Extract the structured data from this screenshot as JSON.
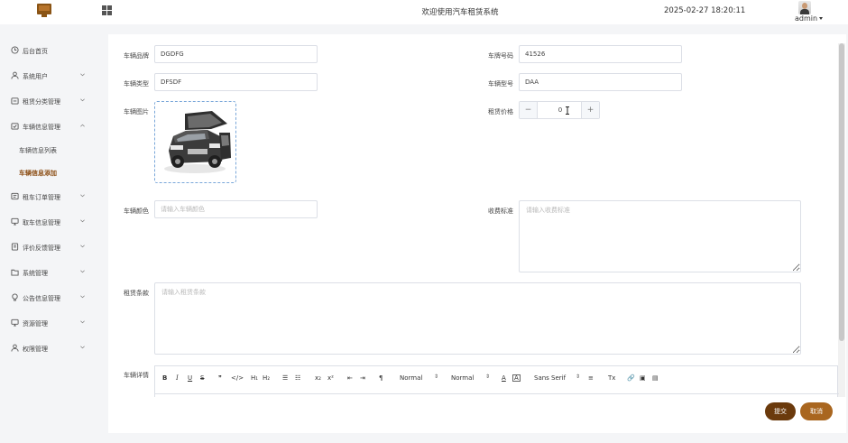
{
  "header": {
    "title": "欢迎使用汽车租赁系统",
    "datetime": "2025-02-27 18:20:11",
    "user": "admin",
    "logo_icon": "monitor-icon",
    "menu_icon": "grid-icon"
  },
  "sidebar": {
    "items": [
      {
        "label": "后台首页",
        "icon": "clock-icon"
      },
      {
        "label": "系统用户",
        "icon": "user-icon"
      },
      {
        "label": "租赁分类管理",
        "icon": "folder-icon"
      },
      {
        "label": "车辆信息管理",
        "icon": "folder-icon"
      },
      {
        "label": "租车订单管理",
        "icon": "tag-icon"
      },
      {
        "label": "取车信息管理",
        "icon": "monitor-icon"
      },
      {
        "label": "评价反馈管理",
        "icon": "doc-icon"
      },
      {
        "label": "系统管理",
        "icon": "folder-icon"
      },
      {
        "label": "公告信息管理",
        "icon": "bulb-icon"
      },
      {
        "label": "资源管理",
        "icon": "monitor-icon"
      },
      {
        "label": "权限管理",
        "icon": "user-icon"
      }
    ],
    "subitems": [
      {
        "label": "车辆信息列表"
      },
      {
        "label": "车辆信息添加"
      }
    ]
  },
  "form": {
    "brand": {
      "label": "车辆品牌",
      "value": "DGDFG"
    },
    "plate": {
      "label": "车牌号码",
      "value": "41526"
    },
    "type": {
      "label": "车辆类型",
      "value": "DFSDF"
    },
    "model": {
      "label": "车辆型号",
      "value": "DAA"
    },
    "image": {
      "label": "车辆图片"
    },
    "price": {
      "label": "租赁价格",
      "value": "0",
      "minus": "−",
      "plus": "+"
    },
    "color": {
      "label": "车辆颜色",
      "placeholder": "请输入车辆颜色"
    },
    "fee": {
      "label": "收费标准",
      "placeholder": "请输入收费标准"
    },
    "terms": {
      "label": "租赁条款",
      "placeholder": "请输入租赁条款"
    },
    "detail": {
      "label": "车辆详情"
    }
  },
  "editor": {
    "bold": "B",
    "italic": "I",
    "underline": "U",
    "strike": "S",
    "quote": "❞",
    "code": "</>",
    "h1": "H₁",
    "h2": "H₂",
    "ol": "☰",
    "ul": "☷",
    "sub": "x₂",
    "sup": "x²",
    "outdent": "⇤",
    "indent": "⇥",
    "rtl": "¶",
    "size": "Normal",
    "header": "Normal",
    "color": "A",
    "background": "A",
    "font": "Sans Serif",
    "align": "≡",
    "clean": "Tx",
    "link": "🔗",
    "image": "▣",
    "video": "▤"
  },
  "actions": {
    "submit": "提交",
    "cancel": "取消"
  },
  "colors": {
    "brand_dark": "#6b3a0c",
    "brand_light": "#a9661f",
    "active_text": "#8a4b10"
  }
}
